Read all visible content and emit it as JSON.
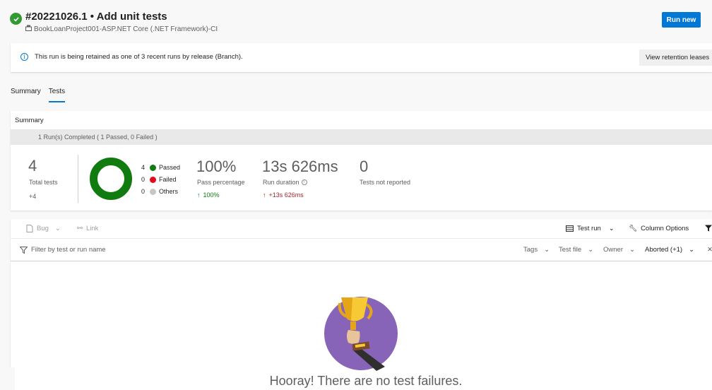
{
  "header": {
    "title": "#20221026.1 • Add unit tests",
    "pipeline": "BookLoanProject001-ASP.NET Core (.NET Framework)-CI",
    "run_new_label": "Run new",
    "status_color": "#339933"
  },
  "banner": {
    "message": "This run is being retained as one of 3 recent runs by release (Branch).",
    "button_label": "View retention leases",
    "icon": "info-icon"
  },
  "tabs": [
    {
      "label": "Summary",
      "selected": false
    },
    {
      "label": "Tests",
      "selected": true
    }
  ],
  "summary": {
    "title": "Summary",
    "runs_completed": "1 Run(s) Completed ( 1 Passed, 0 Failed )",
    "total_tests": {
      "value": "4",
      "label": "Total tests",
      "delta": "+4"
    },
    "outcomes": [
      {
        "count": "4",
        "label": "Passed",
        "color": "#107c10"
      },
      {
        "count": "0",
        "label": "Failed",
        "color": "#e00b1c"
      },
      {
        "count": "0",
        "label": "Others",
        "color": "#c8c6c4"
      }
    ],
    "pass_percentage": {
      "value": "100%",
      "label": "Pass percentage",
      "delta": "100%"
    },
    "run_duration": {
      "value": "13s 626ms",
      "label": "Run duration",
      "delta": "+13s 626ms"
    },
    "not_reported": {
      "value": "0",
      "label": "Tests not reported"
    },
    "pass_fraction": 1.0
  },
  "toolbar": {
    "bug_label": "Bug",
    "link_label": "Link",
    "group_by_label": "Test run",
    "column_options_label": "Column Options"
  },
  "filters": {
    "placeholder": "Filter by test or run name",
    "tags_label": "Tags",
    "test_file_label": "Test file",
    "owner_label": "Owner",
    "outcome_label": "Aborted (+1)"
  },
  "empty_state": {
    "message": "Hooray! There are no test failures."
  },
  "colors": {
    "accent": "#0078d4",
    "passed": "#107c10",
    "delta_up_good": "#107c10",
    "delta_up_neutral": "#a4262c",
    "trophy_bg": "#8764b8"
  }
}
